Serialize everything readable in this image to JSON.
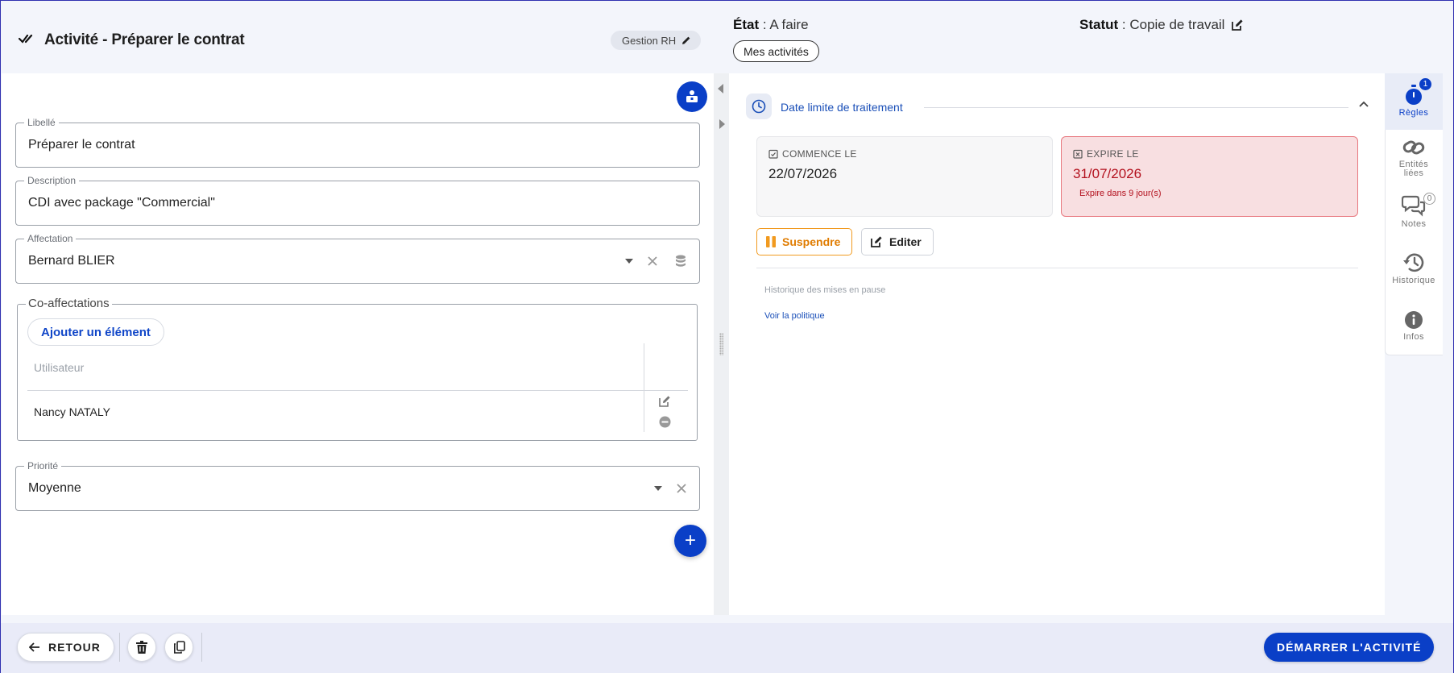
{
  "header": {
    "title": "Activité - Préparer le contrat",
    "chip_label": "Gestion RH",
    "etat_label": "État",
    "etat_value": " : A faire",
    "mes_activites": "Mes activités",
    "statut_label": "Statut",
    "statut_value": " : Copie de travail"
  },
  "form": {
    "libelle": {
      "label": "Libellé",
      "value": "Préparer le contrat"
    },
    "description": {
      "label": "Description",
      "value": "CDI avec package \"Commercial\""
    },
    "affectation": {
      "label": "Affectation",
      "value": "Bernard BLIER"
    },
    "co_affectations": {
      "legend": "Co-affectations",
      "add_label": "Ajouter un élément",
      "column_header": "Utilisateur",
      "rows": [
        {
          "user": "Nancy NATALY"
        }
      ]
    },
    "priorite": {
      "label": "Priorité",
      "value": "Moyenne"
    }
  },
  "deadline": {
    "title": "Date limite de traitement",
    "start_label": "Commence le",
    "start_date": "22/07/2026",
    "end_label": "Expire le",
    "end_date": "31/07/2026",
    "end_note": "Expire dans 9 jour(s)",
    "suspend_label": "Suspendre",
    "edit_label": "Editer",
    "history_text": "Historique des mises en pause",
    "policy_link": "Voir la politique"
  },
  "rail": {
    "items": [
      {
        "label": "Règles",
        "badge": "1"
      },
      {
        "label_line1": "Entités",
        "label_line2": "liées"
      },
      {
        "label": "Notes",
        "badge": "0"
      },
      {
        "label": "Historique"
      },
      {
        "label": "Infos"
      }
    ]
  },
  "footer": {
    "back_label": "RETOUR",
    "start_label": "DÉMARRER L'ACTIVITÉ"
  },
  "colors": {
    "primary": "#0a3fc7",
    "link": "#1a4fb8",
    "warning": "#f19a1f",
    "danger_bg": "#f8dfe1",
    "danger_text": "#b3111e"
  }
}
